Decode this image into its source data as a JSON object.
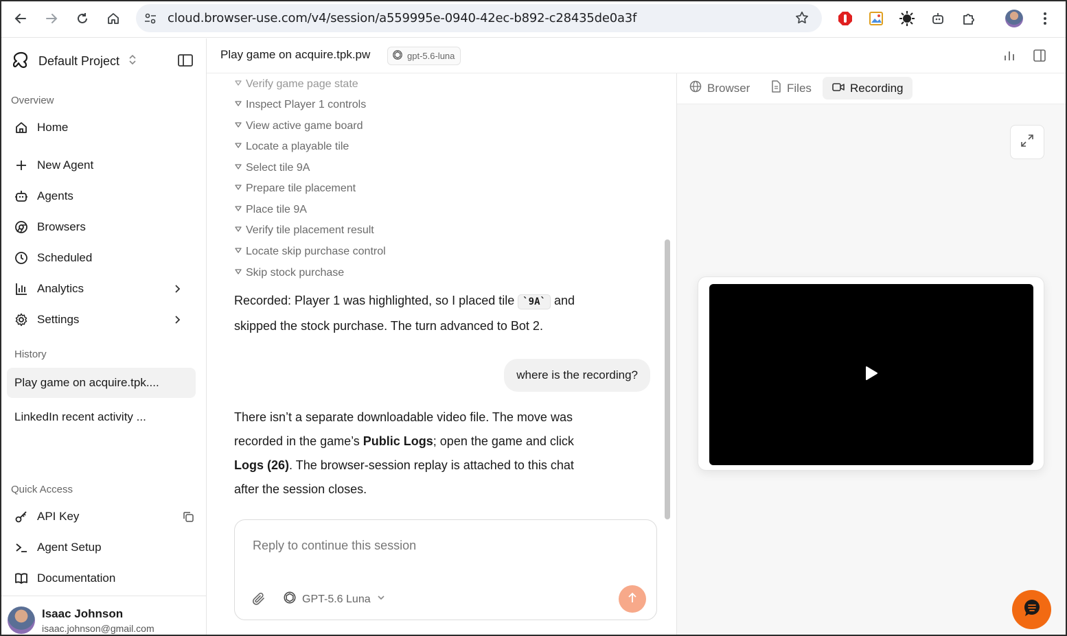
{
  "browser": {
    "url": "cloud.browser-use.com/v4/session/a559995e-0940-42ec-b892-c28435de0a3f"
  },
  "sidebar": {
    "project": "Default Project",
    "overview_label": "Overview",
    "nav": [
      {
        "label": "Home",
        "icon": "home-icon"
      },
      {
        "label": "New Agent",
        "icon": "plus-icon"
      },
      {
        "label": "Agents",
        "icon": "robot-icon"
      },
      {
        "label": "Browsers",
        "icon": "chrome-icon"
      },
      {
        "label": "Scheduled",
        "icon": "clock-icon"
      },
      {
        "label": "Analytics",
        "icon": "bar-chart-icon"
      },
      {
        "label": "Settings",
        "icon": "gear-icon"
      }
    ],
    "history_label": "History",
    "history": [
      {
        "label": "Play game on acquire.tpk...."
      },
      {
        "label": "LinkedIn recent activity ..."
      }
    ],
    "quick_access_label": "Quick Access",
    "quick": [
      {
        "label": "API Key",
        "icon": "key-icon"
      },
      {
        "label": "Agent Setup",
        "icon": "terminal-icon"
      },
      {
        "label": "Documentation",
        "icon": "book-icon"
      }
    ],
    "user": {
      "name": "Isaac Johnson",
      "email": "isaac.johnson@gmail.com"
    }
  },
  "header": {
    "title": "Play game on acquire.tpk.pw",
    "model_badge": "gpt-5.6-luna"
  },
  "chat": {
    "partial_step": "Verify game page state",
    "steps": [
      "Inspect Player 1 controls",
      "View active game board",
      "Locate a playable tile",
      "Select tile 9A",
      "Prepare tile placement",
      "Place tile 9A",
      "Verify tile placement result",
      "Locate skip purchase control",
      "Skip stock purchase"
    ],
    "msg1": {
      "before": "Recorded: Player 1 was highlighted, so I placed tile ",
      "code": "`9A`",
      "after": " and skipped the stock purchase. The turn advanced to Bot 2."
    },
    "user_msg": "where is the recording?",
    "msg2": {
      "p1": "There isn’t a separate downloadable video file. The move was recorded in the game’s ",
      "b1": "Public Logs",
      "p2": "; open the game and click ",
      "b2": "Logs (26)",
      "p3": ". The browser-session replay is attached to this chat after the session closes."
    },
    "composer_placeholder": "Reply to continue this session",
    "composer_model": "GPT-5.6 Luna"
  },
  "panel": {
    "tabs": [
      {
        "label": "Browser",
        "icon": "globe-icon"
      },
      {
        "label": "Files",
        "icon": "file-icon"
      },
      {
        "label": "Recording",
        "icon": "video-icon"
      }
    ],
    "active_tab": "Recording"
  },
  "colors": {
    "accent": "#f26a12",
    "send_button": "#f7a98a",
    "video_bg": "#000000"
  }
}
